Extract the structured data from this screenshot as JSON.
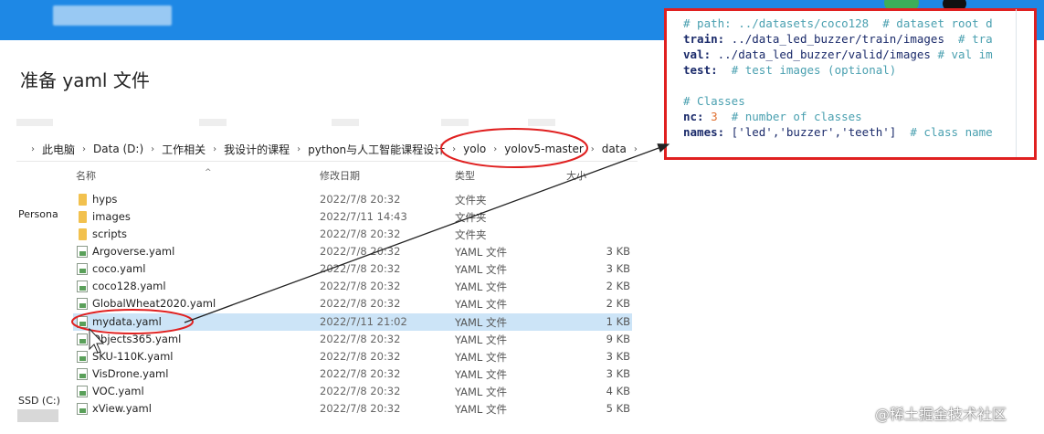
{
  "slide": {
    "title": "准备 yaml 文件"
  },
  "address_bar": {
    "crumbs": [
      "此电脑",
      "Data (D:)",
      "工作相关",
      "我设计的课程",
      "python与人工智能课程设计",
      "yolo",
      "yolov5-master",
      "data"
    ]
  },
  "columns": {
    "name": "名称",
    "date": "修改日期",
    "type": "类型",
    "size": "大小"
  },
  "nav": {
    "persona": "Persona",
    "ssd": "SSD (C:)"
  },
  "files": [
    {
      "name": "hyps",
      "date": "2022/7/8 20:32",
      "type": "文件夹",
      "size": "",
      "kind": "folder"
    },
    {
      "name": "images",
      "date": "2022/7/11 14:43",
      "type": "文件夹",
      "size": "",
      "kind": "folder"
    },
    {
      "name": "scripts",
      "date": "2022/7/8 20:32",
      "type": "文件夹",
      "size": "",
      "kind": "folder"
    },
    {
      "name": "Argoverse.yaml",
      "date": "2022/7/8 20:32",
      "type": "YAML 文件",
      "size": "3 KB",
      "kind": "yaml"
    },
    {
      "name": "coco.yaml",
      "date": "2022/7/8 20:32",
      "type": "YAML 文件",
      "size": "3 KB",
      "kind": "yaml"
    },
    {
      "name": "coco128.yaml",
      "date": "2022/7/8 20:32",
      "type": "YAML 文件",
      "size": "2 KB",
      "kind": "yaml"
    },
    {
      "name": "GlobalWheat2020.yaml",
      "date": "2022/7/8 20:32",
      "type": "YAML 文件",
      "size": "2 KB",
      "kind": "yaml"
    },
    {
      "name": "mydata.yaml",
      "date": "2022/7/11 21:02",
      "type": "YAML 文件",
      "size": "1 KB",
      "kind": "yaml",
      "selected": true
    },
    {
      "name": "Objects365.yaml",
      "date": "2022/7/8 20:32",
      "type": "YAML 文件",
      "size": "9 KB",
      "kind": "yaml"
    },
    {
      "name": "SKU-110K.yaml",
      "date": "2022/7/8 20:32",
      "type": "YAML 文件",
      "size": "3 KB",
      "kind": "yaml"
    },
    {
      "name": "VisDrone.yaml",
      "date": "2022/7/8 20:32",
      "type": "YAML 文件",
      "size": "3 KB",
      "kind": "yaml"
    },
    {
      "name": "VOC.yaml",
      "date": "2022/7/8 20:32",
      "type": "YAML 文件",
      "size": "4 KB",
      "kind": "yaml"
    },
    {
      "name": "xView.yaml",
      "date": "2022/7/8 20:32",
      "type": "YAML 文件",
      "size": "5 KB",
      "kind": "yaml"
    }
  ],
  "code": {
    "line1": "# path: ../datasets/coco128  # dataset root d",
    "line2_key": "train:",
    "line2_val": " ../data_led_buzzer/train/images  ",
    "line2_comment": "# tra",
    "line3_key": "val:",
    "line3_val": " ../data_led_buzzer/valid/images ",
    "line3_comment": "# val im",
    "line4_key": "test:",
    "line4_comment": "  # test images (optional)",
    "line6": "# Classes",
    "line7_key": "nc:",
    "line7_num": " 3",
    "line7_comment": "  # number of classes",
    "line8_key": "names:",
    "line8_val": " ['led','buzzer','teeth']",
    "line8_comment": "  # class name"
  },
  "watermark": "@稀土掘金技术社区",
  "colors": {
    "accent_bar": "#1e88e5",
    "annotation_red": "#e02020",
    "selection": "#cce4f7"
  }
}
